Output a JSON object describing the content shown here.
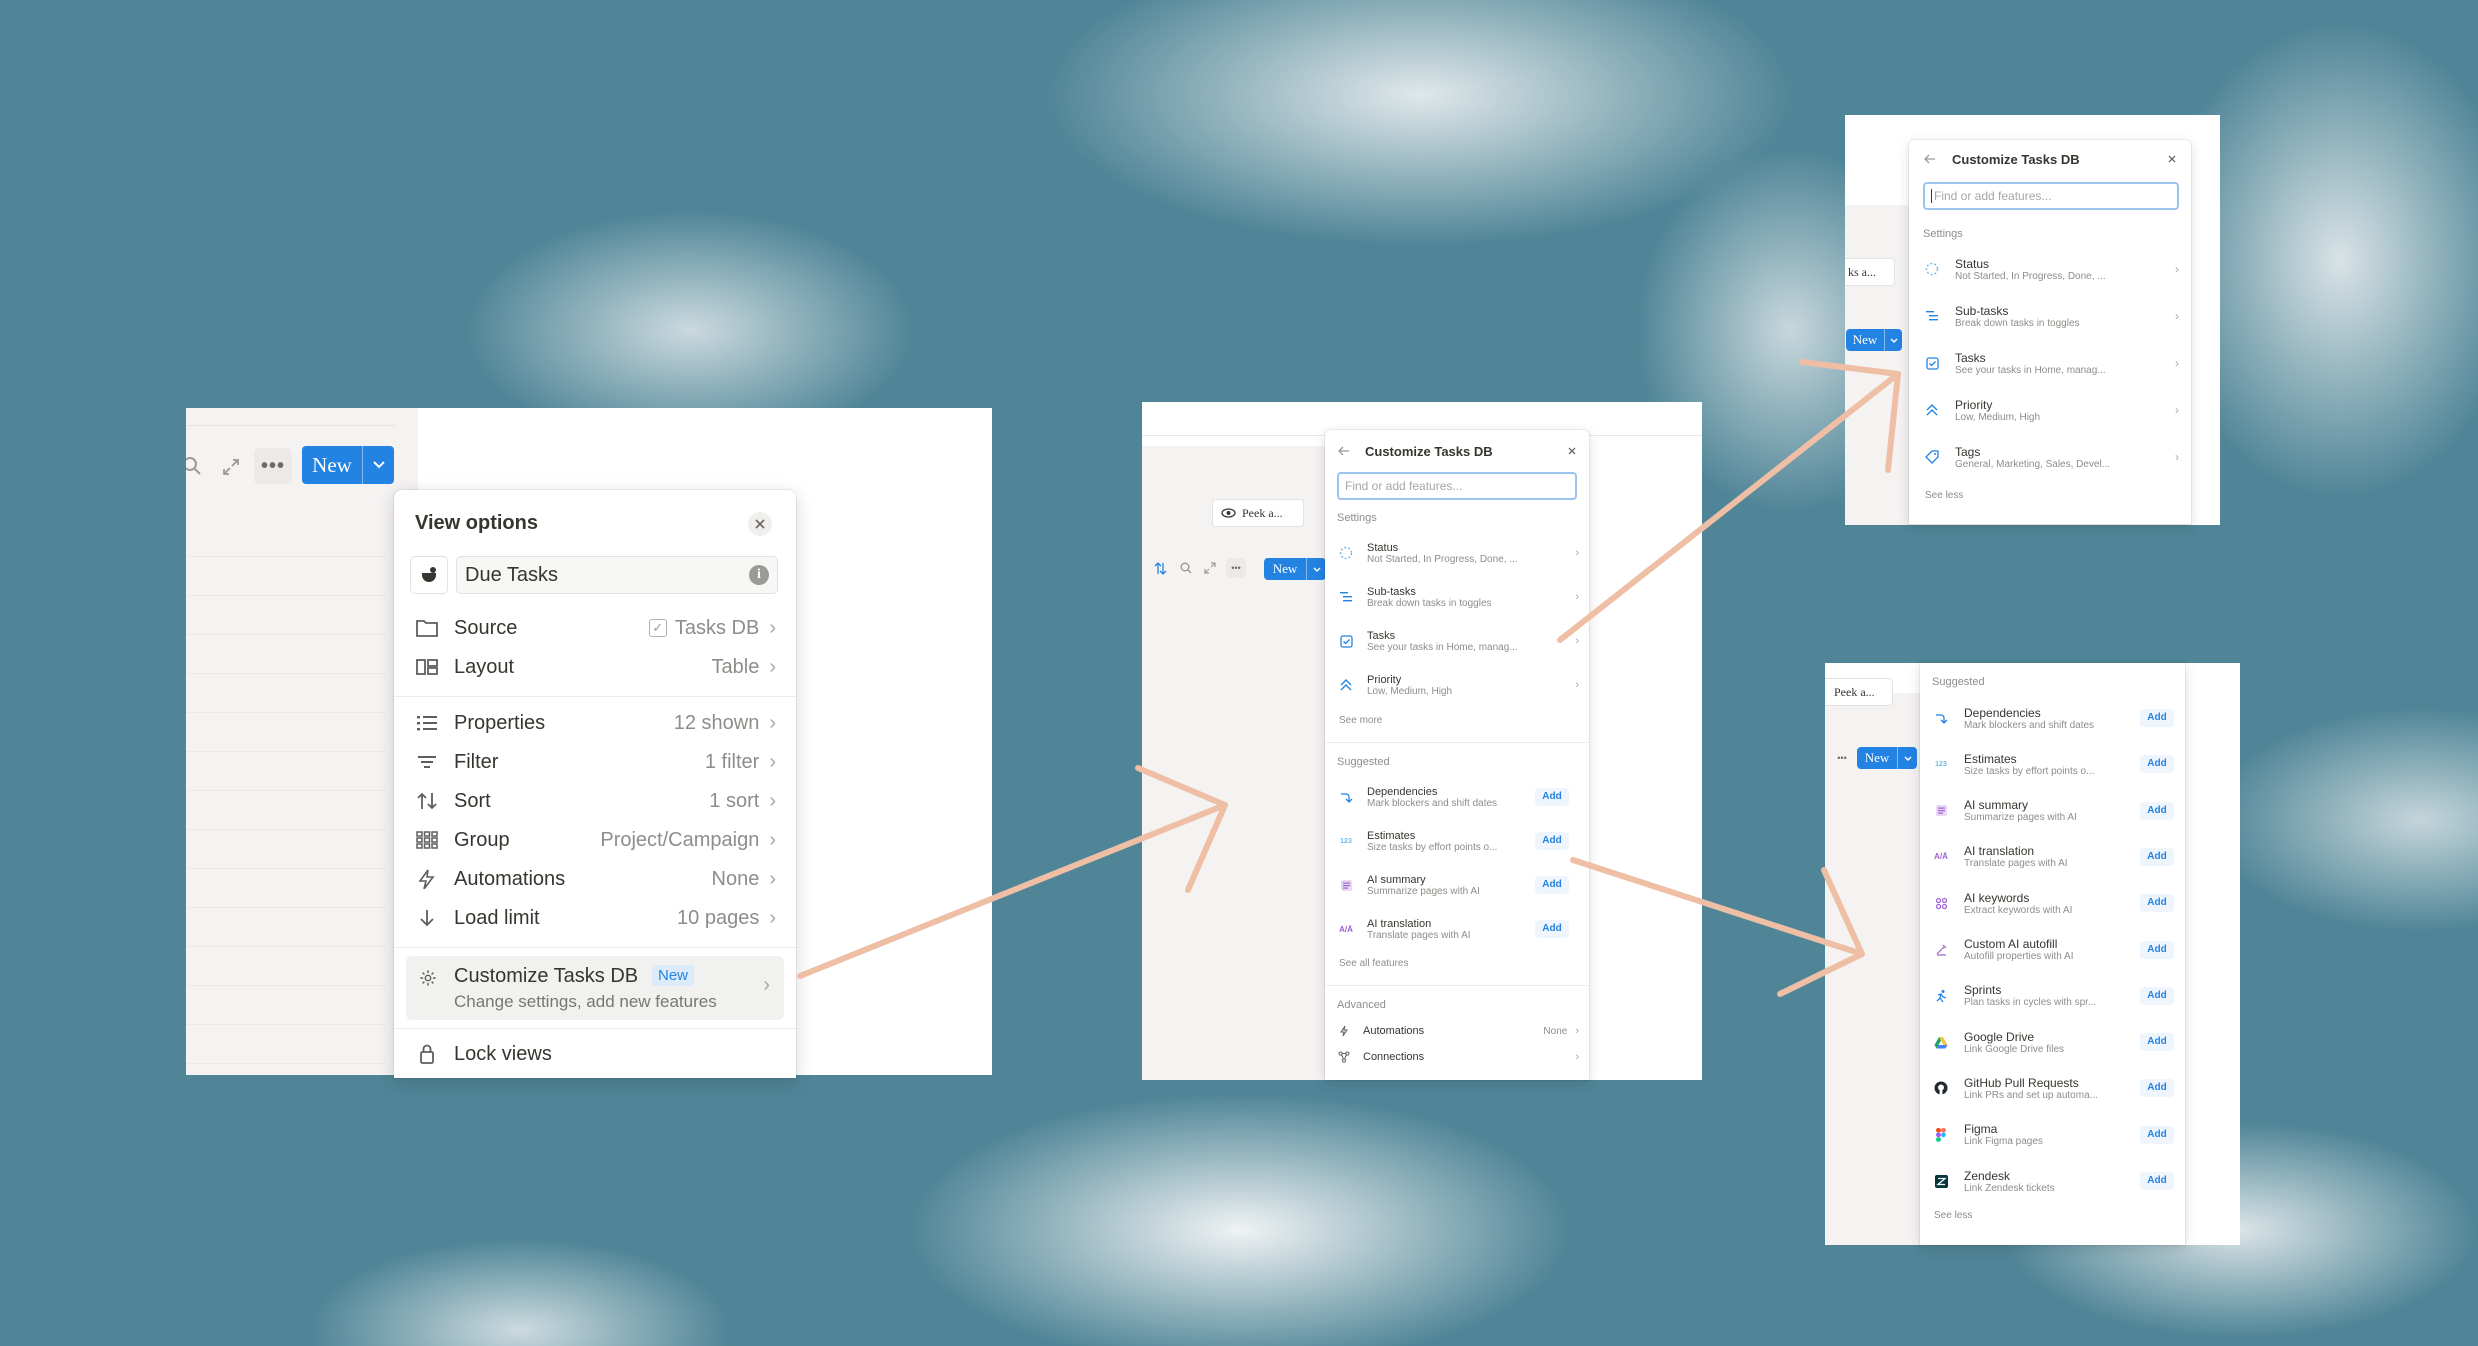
{
  "shot1": {
    "new_button": "New",
    "panel": {
      "title": "View options",
      "view_name": "Due Tasks",
      "options": [
        {
          "label": "Source",
          "value": "Tasks DB"
        },
        {
          "label": "Layout",
          "value": "Table"
        },
        {
          "label": "Properties",
          "value": "12 shown"
        },
        {
          "label": "Filter",
          "value": "1 filter"
        },
        {
          "label": "Sort",
          "value": "1 sort"
        },
        {
          "label": "Group",
          "value": "Project/Campaign"
        },
        {
          "label": "Automations",
          "value": "None"
        },
        {
          "label": "Load limit",
          "value": "10 pages"
        }
      ],
      "customize": {
        "title": "Customize Tasks DB",
        "badge": "New",
        "subtitle": "Change settings, add new features"
      },
      "lock": "Lock views"
    }
  },
  "shot2": {
    "peek": "Peek a...",
    "new_button": "New",
    "panel": {
      "title": "Customize Tasks DB",
      "search_placeholder": "Find or add features...",
      "settings_label": "Settings",
      "settings": [
        {
          "title": "Status",
          "sub": "Not Started, In Progress, Done, ..."
        },
        {
          "title": "Sub-tasks",
          "sub": "Break down tasks in toggles"
        },
        {
          "title": "Tasks",
          "sub": "See your tasks in Home, manag..."
        },
        {
          "title": "Priority",
          "sub": "Low, Medium, High"
        }
      ],
      "see_more": "See more",
      "suggested_label": "Suggested",
      "suggested": [
        {
          "title": "Dependencies",
          "sub": "Mark blockers and shift dates"
        },
        {
          "title": "Estimates",
          "sub": "Size tasks by effort points o..."
        },
        {
          "title": "AI summary",
          "sub": "Summarize pages with AI"
        },
        {
          "title": "AI translation",
          "sub": "Translate pages with AI"
        }
      ],
      "add_label": "Add",
      "see_all": "See all features",
      "advanced_label": "Advanced",
      "automations": {
        "label": "Automations",
        "value": "None"
      },
      "connections": "Connections"
    }
  },
  "shot3": {
    "peek": "ks a...",
    "new_button": "New",
    "panel": {
      "title": "Customize Tasks DB",
      "search_placeholder": "Find or add features...",
      "settings_label": "Settings",
      "settings": [
        {
          "title": "Status",
          "sub": "Not Started, In Progress, Done, ..."
        },
        {
          "title": "Sub-tasks",
          "sub": "Break down tasks in toggles"
        },
        {
          "title": "Tasks",
          "sub": "See your tasks in Home, manag..."
        },
        {
          "title": "Priority",
          "sub": "Low, Medium, High"
        },
        {
          "title": "Tags",
          "sub": "General, Marketing, Sales, Devel..."
        }
      ],
      "see_less": "See less"
    }
  },
  "shot4": {
    "peek": "Peek a...",
    "new_button": "New",
    "panel": {
      "suggested_label": "Suggested",
      "add_label": "Add",
      "items": [
        {
          "title": "Dependencies",
          "sub": "Mark blockers and shift dates"
        },
        {
          "title": "Estimates",
          "sub": "Size tasks by effort points o..."
        },
        {
          "title": "AI summary",
          "sub": "Summarize pages with AI"
        },
        {
          "title": "AI translation",
          "sub": "Translate pages with AI"
        },
        {
          "title": "AI keywords",
          "sub": "Extract keywords with AI"
        },
        {
          "title": "Custom AI autofill",
          "sub": "Autofill properties with AI"
        },
        {
          "title": "Sprints",
          "sub": "Plan tasks in cycles with spr..."
        },
        {
          "title": "Google Drive",
          "sub": "Link Google Drive files"
        },
        {
          "title": "GitHub Pull Requests",
          "sub": "Link PRs and set up automa..."
        },
        {
          "title": "Figma",
          "sub": "Link Figma pages"
        },
        {
          "title": "Zendesk",
          "sub": "Link Zendesk tickets"
        }
      ],
      "see_less": "See less"
    }
  },
  "colors": {
    "accent": "#2383e2",
    "arrow": "#eebfa5",
    "sky": "#4f8597"
  }
}
